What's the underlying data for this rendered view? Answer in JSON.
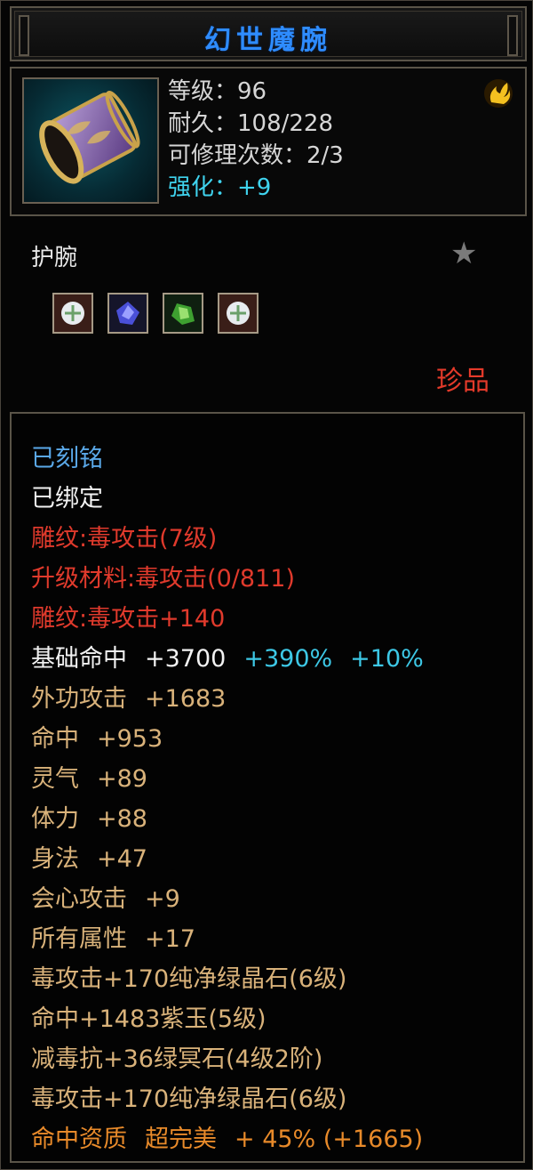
{
  "title": "幻世魔腕",
  "header": {
    "level": "等级：96",
    "durability": "耐久：108/228",
    "repairs": "可修理次数：2/3",
    "enhance": "强化：+9"
  },
  "item_type": "护腕",
  "quality": "珍品",
  "gems": [
    "socket-gem-white",
    "socket-gem-purple",
    "socket-gem-green",
    "socket-gem-white"
  ],
  "attributes": {
    "engraved": "已刻铭",
    "bound": "已绑定",
    "carving": "雕纹:毒攻击(7级)",
    "upgrade_material": "升级材料:毒攻击(0/811)",
    "carving_bonus": "雕纹:毒攻击+140",
    "base_hit": {
      "name": "基础命中",
      "value": "+3700",
      "pct1": "+390%",
      "pct2": "+10%"
    },
    "rows": [
      {
        "name": "外功攻击",
        "value": "+1683"
      },
      {
        "name": "命中",
        "value": "+953"
      },
      {
        "name": "灵气",
        "value": "+89"
      },
      {
        "name": "体力",
        "value": "+88"
      },
      {
        "name": "身法",
        "value": "+47"
      },
      {
        "name": "会心攻击",
        "value": "+9"
      },
      {
        "name": "所有属性",
        "value": "+17"
      }
    ],
    "gem_lines": [
      "毒攻击+170纯净绿晶石(6级)",
      "命中+1483紫玉(5级)",
      "减毒抗+36绿冥石(4级2阶)",
      "毒攻击+170纯净绿晶石(6级)"
    ],
    "aptitude": {
      "name": "命中资质",
      "grade": "超完美",
      "value": "+ 45% (+1665)"
    }
  },
  "colors": {
    "title": "#2e8cff",
    "quality": "#e43a2a",
    "engraved": "#5aa8e8",
    "red": "#e03a2c",
    "gold": "#d9b27a",
    "cyan": "#3dc8e6",
    "aptitude": "#e88a2a"
  }
}
